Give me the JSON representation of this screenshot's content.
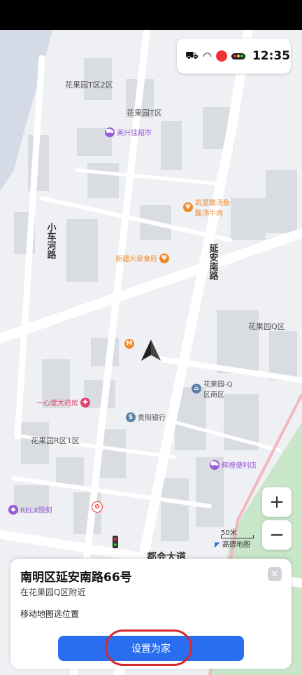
{
  "status_bar": {
    "time": "12:35"
  },
  "map": {
    "area_labels": [
      "花果园T区2区",
      "花果园T区",
      "花果园Q区",
      "花果园R区1区"
    ],
    "road_labels": [
      "小车河路",
      "延安南路",
      "都会大道"
    ],
    "pois": [
      {
        "name": "美兴佳超市",
        "color": "#9b59d6",
        "icon": "cart-icon"
      },
      {
        "name": "凯里酸汤鱼·酸汤牛肉",
        "color": "#f08a2c",
        "icon": "fork-icon"
      },
      {
        "name": "新疆火泉食府",
        "color": "#f08a2c",
        "icon": "fork-icon"
      },
      {
        "name": "一心堂大药房",
        "color": "#e0436d",
        "icon": "pharmacy-icon"
      },
      {
        "name": "贵阳银行",
        "color": "#5b7fa8",
        "icon": "bank-icon"
      },
      {
        "name": "花果园-Q区南区",
        "color": "#5b7fa8",
        "icon": "community-icon"
      },
      {
        "name": "辉煌便利店",
        "color": "#9b59d6",
        "icon": "cart-icon"
      },
      {
        "name": "RELX悦刻",
        "color": "#9b59d6",
        "icon": "shop-icon"
      }
    ],
    "scale_label": "50米",
    "credit": "高德地图",
    "zoom_in": "+",
    "zoom_out": "−"
  },
  "sheet": {
    "title": "南明区延安南路66号",
    "subtitle": "在花果园Q区附近",
    "hint": "移动地图选位置",
    "close": "✕",
    "action_label": "设置为家"
  },
  "colors": {
    "primary": "#2a6ef0",
    "highlight": "#d62a2a"
  }
}
